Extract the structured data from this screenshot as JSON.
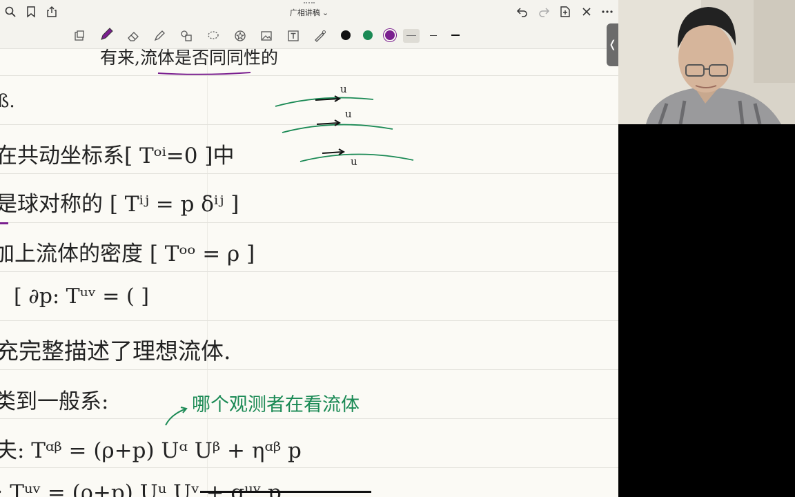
{
  "app": {
    "title": "广相讲稿 ⌄"
  },
  "toolbar": {
    "left_icons": [
      "search-icon",
      "bookmark-icon",
      "share-icon"
    ],
    "right_icons": [
      "undo-icon",
      "redo-icon",
      "add-page-icon",
      "close-icon",
      "more-icon"
    ],
    "tools": [
      "page-layout-icon",
      "pen-icon",
      "eraser-icon",
      "highlighter-icon",
      "shapes-icon",
      "lasso-icon",
      "sticker-icon",
      "image-icon",
      "text-icon",
      "laser-pointer-icon"
    ],
    "colors": [
      "#111111",
      "#1b8a55",
      "#7a1f8f"
    ]
  },
  "notes": {
    "title": "有来,流体是否同同性的",
    "lines": [
      "ß.",
      "在共动坐标系[ Tᵒⁱ=0 ]中",
      "是球对称的 [ Tⁱʲ = p δⁱʲ ]",
      "加上流体的密度 [ Tᵒᵒ = ρ ]",
      "[ ∂p: Tᵘᵛ = (           ]",
      "充完整描述了理想流体.",
      "类到一般系:",
      "夫: Tᵅᵝ = (ρ+p) Uᵅ Uᵝ + ηᵅᵝ p",
      "; Tᵘᵛ = (ρ+p) Uᵘ Uᵛ + gᵘᵛ p"
    ],
    "annotation": "哪个观测者在看流体",
    "flow_labels": [
      "u",
      "u",
      "u"
    ]
  }
}
